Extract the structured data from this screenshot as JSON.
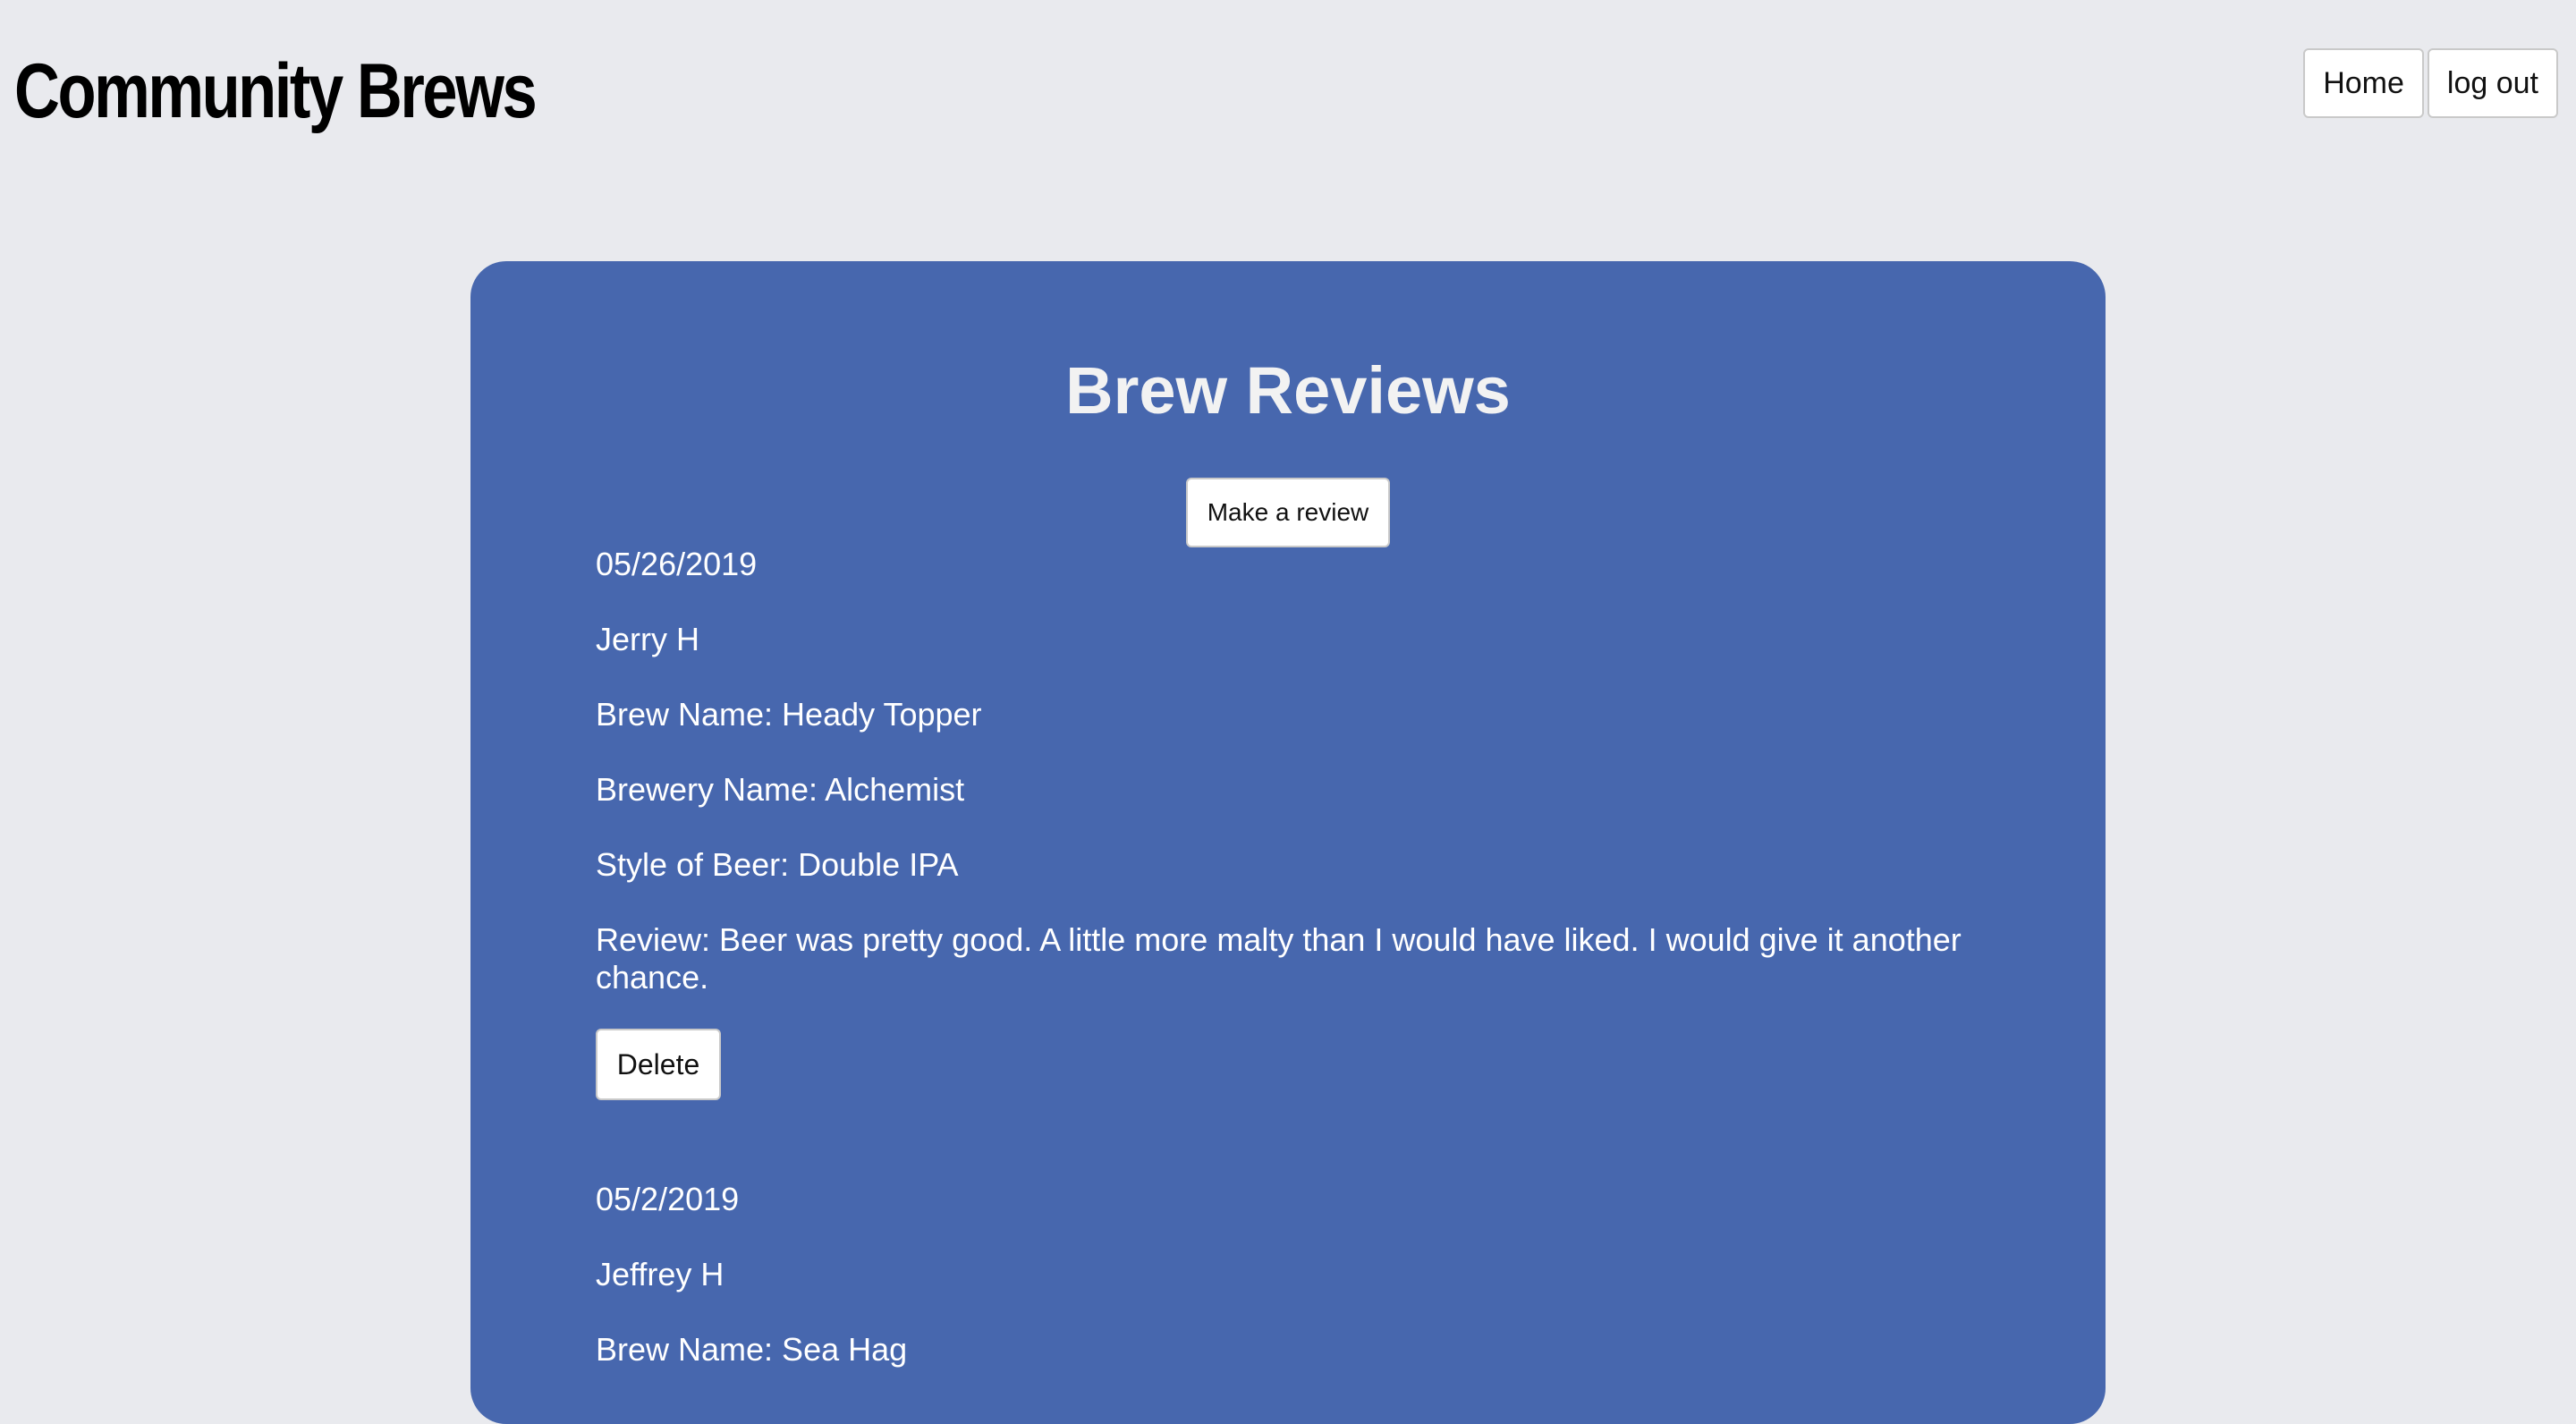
{
  "header": {
    "logo": "Community Brews",
    "nav": {
      "home_label": "Home",
      "logout_label": "log out"
    }
  },
  "main": {
    "title": "Brew Reviews",
    "make_review_label": "Make a review",
    "reviews": [
      {
        "date": "05/26/2019",
        "author": "Jerry H",
        "brew_name": "Brew Name: Heady Topper",
        "brewery_name": "Brewery Name: Alchemist",
        "style": "Style of Beer: Double IPA",
        "review": "Review: Beer was pretty good. A little more malty than I would have liked. I would give it another chance.",
        "delete_label": "Delete"
      },
      {
        "date": "05/2/2019",
        "author": "Jeffrey H",
        "brew_name": "Brew Name: Sea Hag"
      }
    ]
  },
  "colors": {
    "page_background": "#e9eaee",
    "card_background": "#4767ae",
    "card_text": "#ffffff"
  }
}
